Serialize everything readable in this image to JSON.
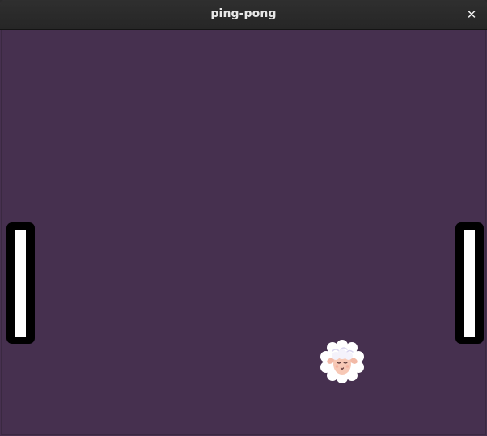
{
  "window": {
    "title": "ping-pong",
    "close_glyph": "✕"
  },
  "game": {
    "background_color": "#46304f",
    "paddle_outline_color": "#000000",
    "paddle_fill_color": "#ffffff",
    "ball_icon": "sheep-icon"
  }
}
